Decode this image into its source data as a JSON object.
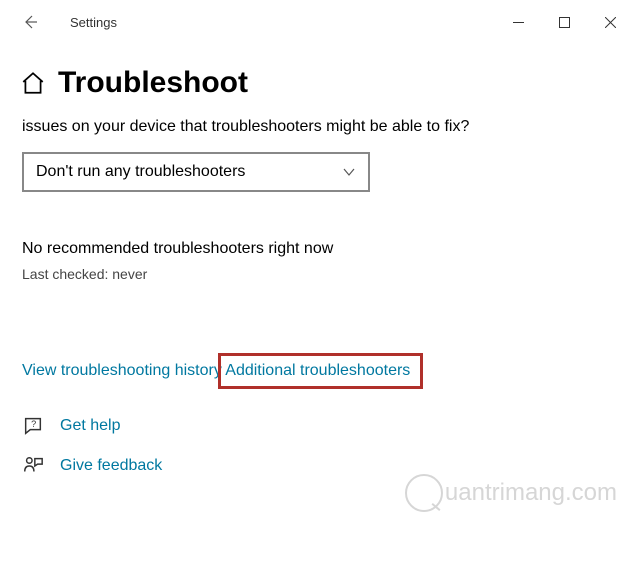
{
  "titlebar": {
    "app_title": "Settings"
  },
  "header": {
    "page_title": "Troubleshoot"
  },
  "main": {
    "intro_text": "issues on your device that troubleshooters might be able to fix?",
    "dropdown_value": "Don't run any troubleshooters",
    "status_text": "No recommended troubleshooters right now",
    "last_checked": "Last checked: never",
    "history_link": "View troubleshooting history",
    "additional_link": "Additional troubleshooters"
  },
  "help": {
    "get_help": "Get help",
    "give_feedback": "Give feedback"
  },
  "watermark": "uantrimang.com"
}
